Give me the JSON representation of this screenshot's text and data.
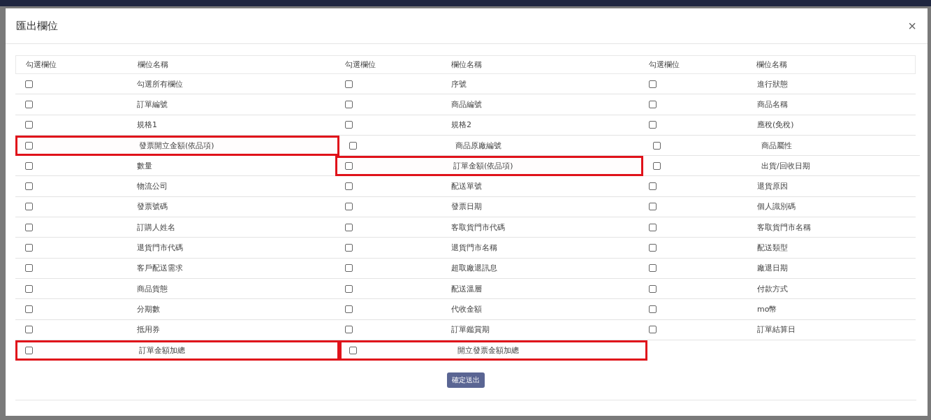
{
  "dialog": {
    "title": "匯出欄位",
    "close": "×"
  },
  "table": {
    "columns": [
      {
        "check_label": "勾選欄位",
        "name_label": "欄位名稱"
      },
      {
        "check_label": "勾選欄位",
        "name_label": "欄位名稱"
      },
      {
        "check_label": "勾選欄位",
        "name_label": "欄位名稱"
      }
    ],
    "rows": [
      [
        {
          "name": "勾選所有欄位",
          "checked": false,
          "highlighted": false
        },
        {
          "name": "序號",
          "checked": false,
          "highlighted": false
        },
        {
          "name": "進行狀態",
          "checked": false,
          "highlighted": false
        }
      ],
      [
        {
          "name": "訂單編號",
          "checked": false,
          "highlighted": false
        },
        {
          "name": "商品編號",
          "checked": false,
          "highlighted": false
        },
        {
          "name": "商品名稱",
          "checked": false,
          "highlighted": false
        }
      ],
      [
        {
          "name": "規格1",
          "checked": false,
          "highlighted": false
        },
        {
          "name": "規格2",
          "checked": false,
          "highlighted": false
        },
        {
          "name": "應稅(免稅)",
          "checked": false,
          "highlighted": false
        }
      ],
      [
        {
          "name": "發票開立金額(依品項)",
          "checked": false,
          "highlighted": true
        },
        {
          "name": "商品原廠編號",
          "checked": false,
          "highlighted": false
        },
        {
          "name": "商品屬性",
          "checked": false,
          "highlighted": false
        }
      ],
      [
        {
          "name": "數量",
          "checked": false,
          "highlighted": false
        },
        {
          "name": "訂單金額(依品項)",
          "checked": false,
          "highlighted": true
        },
        {
          "name": "出貨/回收日期",
          "checked": false,
          "highlighted": false
        }
      ],
      [
        {
          "name": "物流公司",
          "checked": false,
          "highlighted": false
        },
        {
          "name": "配送單號",
          "checked": false,
          "highlighted": false
        },
        {
          "name": "退貨原因",
          "checked": false,
          "highlighted": false
        }
      ],
      [
        {
          "name": "發票號碼",
          "checked": false,
          "highlighted": false
        },
        {
          "name": "發票日期",
          "checked": false,
          "highlighted": false
        },
        {
          "name": "個人識別碼",
          "checked": false,
          "highlighted": false
        }
      ],
      [
        {
          "name": "訂購人姓名",
          "checked": false,
          "highlighted": false
        },
        {
          "name": "客取貨門市代碼",
          "checked": false,
          "highlighted": false
        },
        {
          "name": "客取貨門市名稱",
          "checked": false,
          "highlighted": false
        }
      ],
      [
        {
          "name": "退貨門市代碼",
          "checked": false,
          "highlighted": false
        },
        {
          "name": "退貨門市名稱",
          "checked": false,
          "highlighted": false
        },
        {
          "name": "配送類型",
          "checked": false,
          "highlighted": false
        }
      ],
      [
        {
          "name": "客戶配送需求",
          "checked": false,
          "highlighted": false
        },
        {
          "name": "超取廠退訊息",
          "checked": false,
          "highlighted": false
        },
        {
          "name": "廠退日期",
          "checked": false,
          "highlighted": false
        }
      ],
      [
        {
          "name": "商品貨態",
          "checked": false,
          "highlighted": false
        },
        {
          "name": "配送溫層",
          "checked": false,
          "highlighted": false
        },
        {
          "name": "付款方式",
          "checked": false,
          "highlighted": false
        }
      ],
      [
        {
          "name": "分期數",
          "checked": false,
          "highlighted": false
        },
        {
          "name": "代收金額",
          "checked": false,
          "highlighted": false
        },
        {
          "name": "mo幣",
          "checked": false,
          "highlighted": false
        }
      ],
      [
        {
          "name": "抵用券",
          "checked": false,
          "highlighted": false
        },
        {
          "name": "訂單鑑賞期",
          "checked": false,
          "highlighted": false
        },
        {
          "name": "訂單結算日",
          "checked": false,
          "highlighted": false
        }
      ],
      [
        {
          "name": "訂單金額加總",
          "checked": false,
          "highlighted": true
        },
        {
          "name": "開立發票金額加總",
          "checked": false,
          "highlighted": true
        }
      ]
    ]
  },
  "submit_button": "確定送出"
}
